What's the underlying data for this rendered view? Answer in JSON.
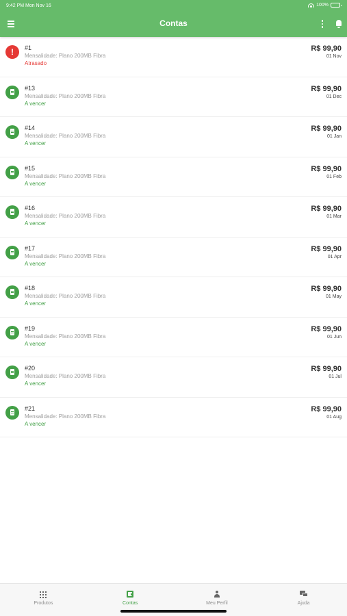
{
  "status_bar": {
    "time": "9:42 PM",
    "date": "Mon Nov 16",
    "battery": "100%"
  },
  "header": {
    "title": "Contas",
    "icons": [
      "menu-icon",
      "more-vertical-icon",
      "bell-icon"
    ]
  },
  "bills": [
    {
      "number": "#1",
      "description": "Mensalidade: Plano 200MB Fibra",
      "status": "Atrasado",
      "amount": "R$ 99,90",
      "due": "01 Nov",
      "overdue": true
    },
    {
      "number": "#13",
      "description": "Mensalidade: Plano 200MB Fibra",
      "status": "A vencer",
      "amount": "R$ 99,90",
      "due": "01 Dec",
      "overdue": false
    },
    {
      "number": "#14",
      "description": "Mensalidade: Plano 200MB Fibra",
      "status": "A vencer",
      "amount": "R$ 99,90",
      "due": "01 Jan",
      "overdue": false
    },
    {
      "number": "#15",
      "description": "Mensalidade: Plano 200MB Fibra",
      "status": "A vencer",
      "amount": "R$ 99,90",
      "due": "01 Feb",
      "overdue": false
    },
    {
      "number": "#16",
      "description": "Mensalidade: Plano 200MB Fibra",
      "status": "A vencer",
      "amount": "R$ 99,90",
      "due": "01 Mar",
      "overdue": false
    },
    {
      "number": "#17",
      "description": "Mensalidade: Plano 200MB Fibra",
      "status": "A vencer",
      "amount": "R$ 99,90",
      "due": "01 Apr",
      "overdue": false
    },
    {
      "number": "#18",
      "description": "Mensalidade: Plano 200MB Fibra",
      "status": "A vencer",
      "amount": "R$ 99,90",
      "due": "01 May",
      "overdue": false
    },
    {
      "number": "#19",
      "description": "Mensalidade: Plano 200MB Fibra",
      "status": "A vencer",
      "amount": "R$ 99,90",
      "due": "01 Jun",
      "overdue": false
    },
    {
      "number": "#20",
      "description": "Mensalidade: Plano 200MB Fibra",
      "status": "A vencer",
      "amount": "R$ 99,90",
      "due": "01 Jul",
      "overdue": false
    },
    {
      "number": "#21",
      "description": "Mensalidade: Plano 200MB Fibra",
      "status": "A vencer",
      "amount": "R$ 99,90",
      "due": "01 Aug",
      "overdue": false
    }
  ],
  "tabs": [
    {
      "label": "Produtos",
      "icon": "grid-icon",
      "active": false
    },
    {
      "label": "Contas",
      "icon": "wallet-icon",
      "active": true
    },
    {
      "label": "Meu Perfil",
      "icon": "person-icon",
      "active": false
    },
    {
      "label": "Ajuda",
      "icon": "chat-icon",
      "active": false
    }
  ],
  "colors": {
    "primary": "#66bb6a",
    "success": "#43a047",
    "danger": "#e53935",
    "text_muted": "#9e9e9e"
  }
}
